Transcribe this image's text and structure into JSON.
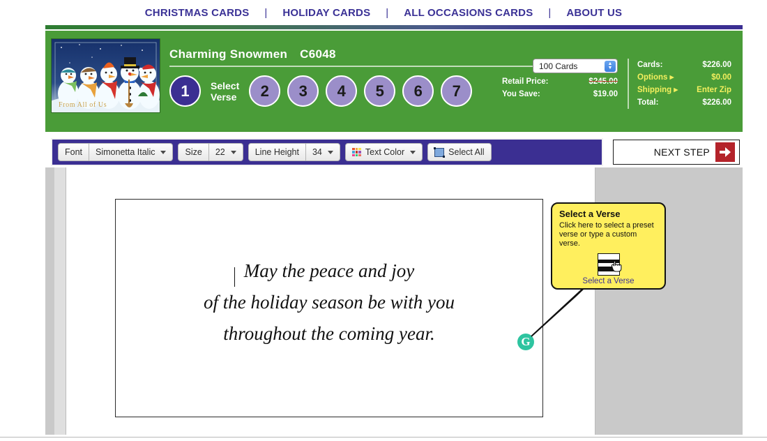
{
  "nav": {
    "separator": "|",
    "items": [
      {
        "label": "CHRISTMAS CARDS"
      },
      {
        "label": "HOLIDAY CARDS"
      },
      {
        "label": "ALL OCCASIONS CARDS"
      },
      {
        "label": "ABOUT US"
      }
    ]
  },
  "header": {
    "product_name": "Charming Snowmen",
    "product_code": "C6048",
    "thumbnail_caption": "From All of Us",
    "thumbnail_alt": "snowmen-illustration",
    "steps": [
      {
        "number": "1",
        "active": true
      },
      {
        "number": "2",
        "active": false
      },
      {
        "number": "3",
        "active": false
      },
      {
        "number": "4",
        "active": false
      },
      {
        "number": "5",
        "active": false
      },
      {
        "number": "6",
        "active": false
      },
      {
        "number": "7",
        "active": false
      }
    ],
    "active_step_label": "Select\nVerse"
  },
  "pricing": {
    "quantity_value": "100 Cards",
    "retail_price_label": "Retail Price:",
    "retail_price_value": "$245.00",
    "you_save_label": "You Save:",
    "you_save_value": "$19.00",
    "cards_label": "Cards:",
    "cards_value": "$226.00",
    "options_label": "Options ▸",
    "options_value": "$0.00",
    "shipping_label": "Shipping ▸",
    "shipping_value": "Enter Zip",
    "total_label": "Total:",
    "total_value": "$226.00"
  },
  "toolbar": {
    "font_label": "Font",
    "font_value": "Simonetta Italic",
    "size_label": "Size",
    "size_value": "22",
    "line_height_label": "Line Height",
    "line_height_value": "34",
    "text_color_label": "Text Color",
    "select_all_label": "Select All",
    "color_swatches": [
      "#e8532a",
      "#f2a63b",
      "#f6e14a",
      "#4aa3d8",
      "#c0392b",
      "#9b59b6",
      "#e84393",
      "#2ecc71",
      "#ec7063"
    ]
  },
  "next_step": {
    "label": "NEXT STEP",
    "arrow": "➡"
  },
  "canvas": {
    "verse_text": "May the peace and joy\nof the holiday season be with you\nthroughout the coming year.",
    "refresh_label": "G"
  },
  "callout": {
    "title": "Select a Verse",
    "body": "Click here to select a preset verse or type a custom verse.",
    "link_label": "Select a Verse",
    "cursor": "Ὓ0"
  },
  "colors": {
    "brand_purple": "#3b2f92",
    "brand_green": "#4a9c38",
    "accent_yellow": "#f3ef5e",
    "callout_yellow": "#ffef5e",
    "next_red": "#b4232a",
    "refresh_green": "#2ec4a0"
  }
}
